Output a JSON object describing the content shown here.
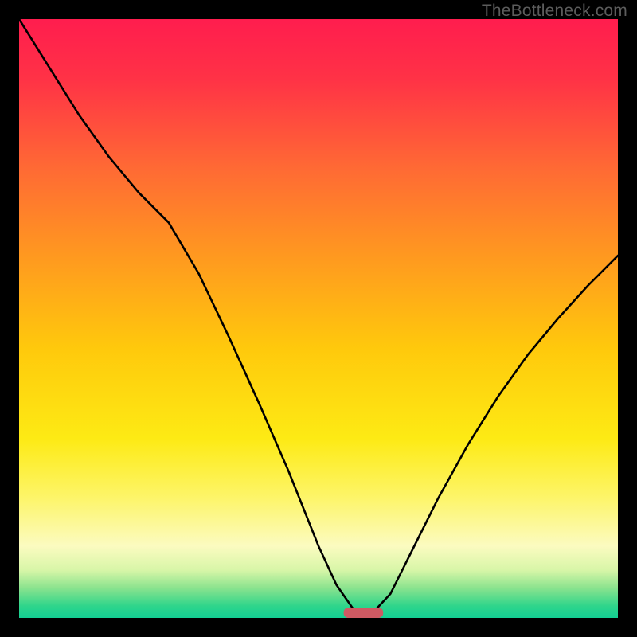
{
  "watermark": "TheBottleneck.com",
  "chart_data": {
    "type": "line",
    "title": "",
    "xlabel": "",
    "ylabel": "",
    "xlim": [
      0,
      1
    ],
    "ylim": [
      0,
      1
    ],
    "annotations": [],
    "notes": "Unlabeled axes; both axes appear normalized 0–1. Background is a vertical heat gradient (red→yellow→pale-yellow→green) with a single black V-shaped curve reaching its minimum near x≈0.57. A short red pill marker sits at the curve minimum on the x-axis.",
    "background_gradient_stops": [
      {
        "offset": 0.0,
        "color": "#ff1d4e"
      },
      {
        "offset": 0.1,
        "color": "#ff3246"
      },
      {
        "offset": 0.25,
        "color": "#ff6a34"
      },
      {
        "offset": 0.4,
        "color": "#ff9a1f"
      },
      {
        "offset": 0.55,
        "color": "#ffc90c"
      },
      {
        "offset": 0.7,
        "color": "#fdea14"
      },
      {
        "offset": 0.8,
        "color": "#fdf56a"
      },
      {
        "offset": 0.88,
        "color": "#fbfbc0"
      },
      {
        "offset": 0.92,
        "color": "#d8f6a8"
      },
      {
        "offset": 0.95,
        "color": "#8be38e"
      },
      {
        "offset": 0.98,
        "color": "#2fd58b"
      },
      {
        "offset": 1.0,
        "color": "#13cf93"
      }
    ],
    "series": [
      {
        "name": "bottleneck-curve",
        "x": [
          0.0,
          0.05,
          0.1,
          0.15,
          0.2,
          0.25,
          0.3,
          0.35,
          0.4,
          0.45,
          0.5,
          0.53,
          0.56,
          0.59,
          0.62,
          0.66,
          0.7,
          0.75,
          0.8,
          0.85,
          0.9,
          0.95,
          1.0
        ],
        "y": [
          1.0,
          0.92,
          0.84,
          0.77,
          0.71,
          0.66,
          0.575,
          0.47,
          0.36,
          0.245,
          0.12,
          0.055,
          0.012,
          0.008,
          0.04,
          0.12,
          0.2,
          0.29,
          0.37,
          0.44,
          0.5,
          0.555,
          0.605
        ]
      }
    ],
    "marker": {
      "name": "min-marker",
      "x_center": 0.575,
      "y": 0.0,
      "width_frac": 0.066,
      "color": "#cf5a63"
    }
  }
}
